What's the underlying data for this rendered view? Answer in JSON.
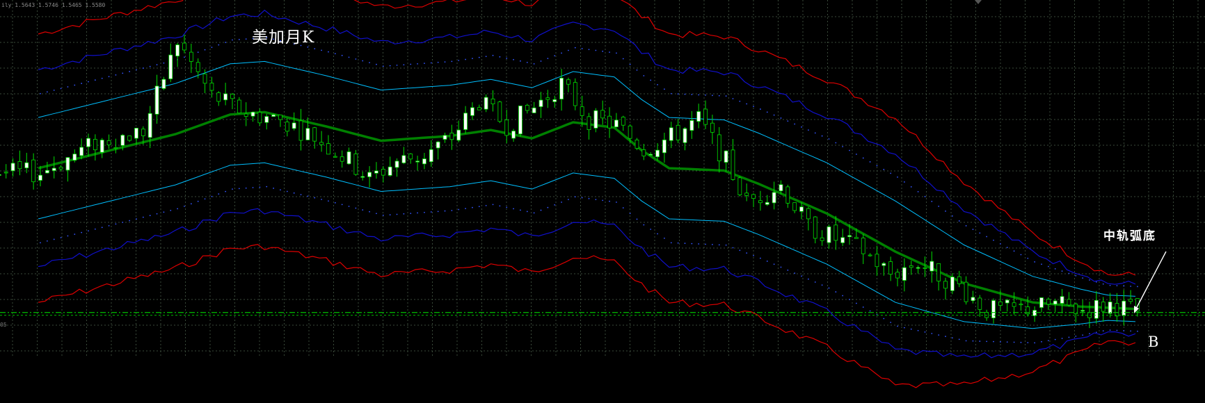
{
  "header": {
    "ohlc": "ily  1.5643  1.5746  1.5465  1.5580"
  },
  "chart_title": "美加月K",
  "annotations": {
    "arc_bottom": "中轨弧底",
    "signal": "B",
    "price_tick": "05"
  },
  "colors": {
    "background": "#000000",
    "grid": "#3a4a3a",
    "candle_bull": "#ffffff",
    "candle_bear": "#000000",
    "wick": "#00e000",
    "middle_band": "#008000",
    "inner_band": "#00bfff",
    "mid_band": "#1010cc",
    "outer_band": "#dd0000",
    "dots": "#3355ff",
    "price_line": "#00c000"
  },
  "chart_data": {
    "type": "candlestick",
    "title": "美加月K",
    "ylim": [
      1.02,
      1.62
    ],
    "x_count": 160,
    "current_price": 1.096,
    "middle_band_anchors": [
      [
        0,
        1.338
      ],
      [
        20,
        1.395
      ],
      [
        28,
        1.428
      ],
      [
        33,
        1.432
      ],
      [
        42,
        1.408
      ],
      [
        50,
        1.384
      ],
      [
        60,
        1.392
      ],
      [
        66,
        1.402
      ],
      [
        72,
        1.388
      ],
      [
        78,
        1.415
      ],
      [
        84,
        1.406
      ],
      [
        88,
        1.368
      ],
      [
        92,
        1.338
      ],
      [
        100,
        1.334
      ],
      [
        105,
        1.312
      ],
      [
        115,
        1.262
      ],
      [
        125,
        1.198
      ],
      [
        135,
        1.145
      ],
      [
        145,
        1.113
      ],
      [
        152,
        1.106
      ],
      [
        160,
        1.102
      ]
    ],
    "inner_band_width": 0.085,
    "mid_band_width": 0.165,
    "outer_band_width": 0.225,
    "candles_close_path": [
      [
        0,
        1.33
      ],
      [
        8,
        1.38
      ],
      [
        15,
        1.4
      ],
      [
        20,
        1.55
      ],
      [
        25,
        1.46
      ],
      [
        30,
        1.43
      ],
      [
        35,
        1.42
      ],
      [
        40,
        1.39
      ],
      [
        45,
        1.35
      ],
      [
        48,
        1.32
      ],
      [
        52,
        1.35
      ],
      [
        56,
        1.36
      ],
      [
        60,
        1.39
      ],
      [
        64,
        1.45
      ],
      [
        68,
        1.41
      ],
      [
        72,
        1.44
      ],
      [
        76,
        1.48
      ],
      [
        80,
        1.42
      ],
      [
        84,
        1.41
      ],
      [
        88,
        1.37
      ],
      [
        92,
        1.39
      ],
      [
        96,
        1.42
      ],
      [
        100,
        1.35
      ],
      [
        103,
        1.28
      ],
      [
        108,
        1.31
      ],
      [
        112,
        1.24
      ],
      [
        116,
        1.22
      ],
      [
        120,
        1.2
      ],
      [
        124,
        1.16
      ],
      [
        128,
        1.18
      ],
      [
        134,
        1.14
      ],
      [
        138,
        1.1
      ],
      [
        142,
        1.1
      ],
      [
        148,
        1.11
      ],
      [
        152,
        1.1
      ],
      [
        156,
        1.11
      ],
      [
        160,
        1.098
      ]
    ]
  }
}
